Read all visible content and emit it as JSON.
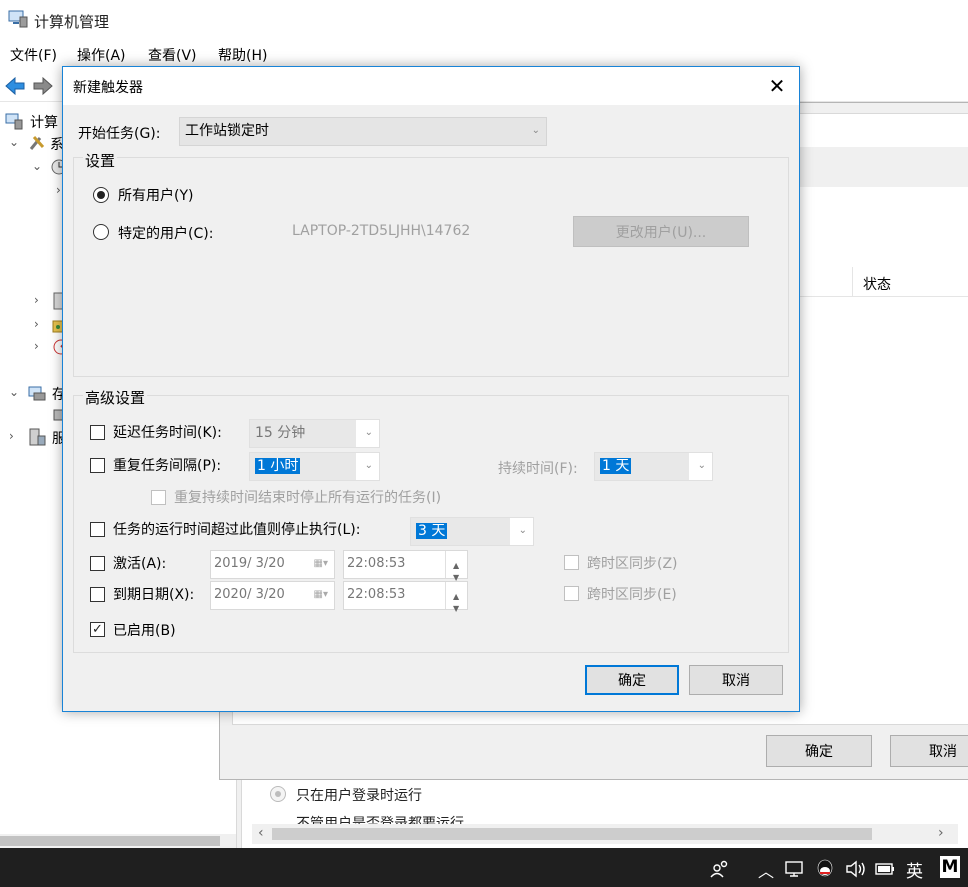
{
  "bg_window": {
    "title": "计算机管理",
    "menu": [
      "文件(F)",
      "操作(A)",
      "查看(V)",
      "帮助(H)"
    ],
    "tree": [
      {
        "chevron": "",
        "label": "计算"
      },
      {
        "chevron": "⌄",
        "label": "系"
      },
      {
        "chevron": "⌄",
        "label": ""
      },
      {
        "chevron": "›",
        "label": ""
      },
      {
        "chevron": "›",
        "label": ""
      },
      {
        "chevron": "›",
        "label": ""
      },
      {
        "chevron": "›",
        "label": ""
      },
      {
        "chevron": "⌄",
        "label": "存"
      },
      {
        "chevron": "›",
        "label": "服"
      }
    ]
  },
  "props_dialog": {
    "column_status": "状态",
    "ok_label": "确定",
    "cancel_label": "取消"
  },
  "bottom_pane": {
    "radio1": "只在用户登录时运行",
    "radio2": "不管用户是否登录都要运行"
  },
  "taskbar": {
    "ime": "英",
    "m_icon": "M"
  },
  "trigger_dialog": {
    "title": "新建触发器",
    "close_glyph": "✕",
    "begin_task_label": "开始任务(G):",
    "begin_task_value": "工作站锁定时",
    "settings_title": "设置",
    "radio_all_users": "所有用户(Y)",
    "radio_specific_user": "特定的用户(C):",
    "specific_user_value": "LAPTOP-2TD5LJHH\\14762",
    "change_user_button": "更改用户(U)...",
    "advanced_title": "高级设置",
    "delay_label": "延迟任务时间(K):",
    "delay_value": "15 分钟",
    "repeat_label": "重复任务间隔(P):",
    "repeat_value": "1 小时",
    "duration_label": "持续时间(F):",
    "duration_value": "1 天",
    "stop_at_end_label": "重复持续时间结束时停止所有运行的任务(I)",
    "stop_if_longer_label": "任务的运行时间超过此值则停止执行(L):",
    "stop_if_longer_value": "3 天",
    "activate_label": "激活(A):",
    "activate_date": "2019/  3/20",
    "activate_time": "22:08:53",
    "activate_sync": "跨时区同步(Z)",
    "expire_label": "到期日期(X):",
    "expire_date": "2020/  3/20",
    "expire_time": "22:08:53",
    "expire_sync": "跨时区同步(E)",
    "enabled_label": "已启用(B)",
    "enabled_checked": true,
    "ok_label": "确定",
    "cancel_label": "取消"
  }
}
